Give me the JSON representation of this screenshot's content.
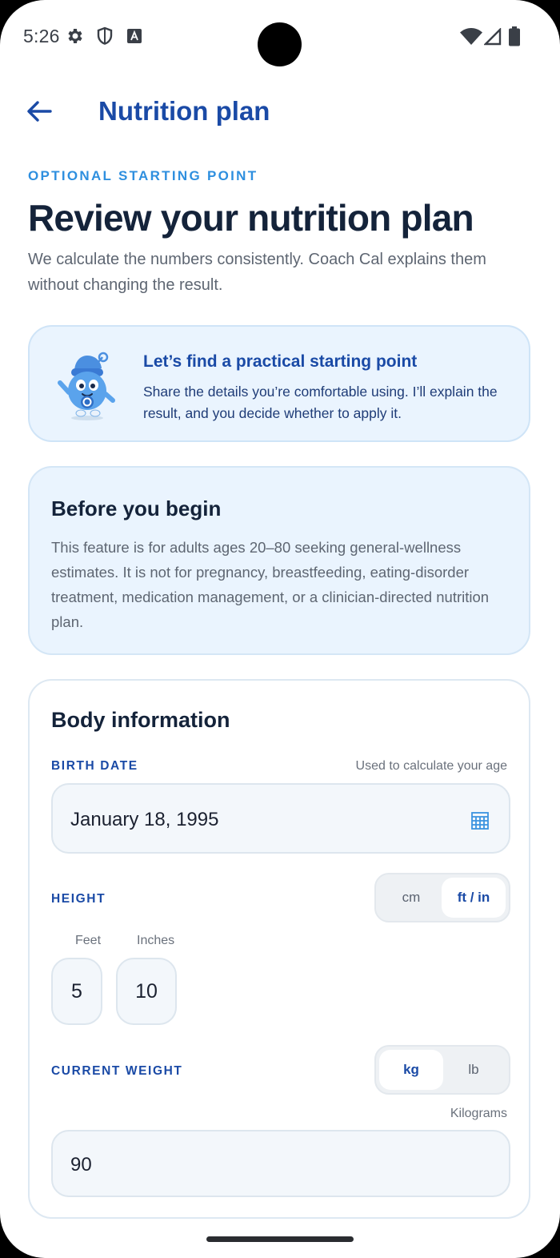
{
  "status_bar": {
    "time": "5:26",
    "icons": [
      "gear-icon",
      "shield-icon",
      "font-a-icon",
      "wifi-icon",
      "signal-icon",
      "battery-icon"
    ]
  },
  "app_bar": {
    "title": "Nutrition plan",
    "back_icon": "arrow-left-icon"
  },
  "header": {
    "eyebrow": "OPTIONAL STARTING POINT",
    "headline": "Review your nutrition plan",
    "subtitle": "We calculate the numbers consistently. Coach Cal explains them without changing the result."
  },
  "coach_card": {
    "title": "Let’s find a practical starting point",
    "text": "Share the details you’re comfortable using. I’ll explain the result, and you decide whether to apply it.",
    "mascot": "coach-cal-mascot"
  },
  "before_card": {
    "title": "Before you begin",
    "text": "This feature is for adults ages 20–80 seeking general-wellness estimates. It is not for pregnancy, breastfeeding, eating-disorder treatment, medication management, or a clinician-directed nutrition plan."
  },
  "body_info": {
    "title": "Body information",
    "birth_date": {
      "label": "BIRTH DATE",
      "hint": "Used to calculate your age",
      "value": "January 18, 1995",
      "icon": "calendar-icon"
    },
    "height": {
      "label": "HEIGHT",
      "units": [
        "cm",
        "ft / in"
      ],
      "selected_unit": "ft / in",
      "feet_label": "Feet",
      "inches_label": "Inches",
      "feet_value": "5",
      "inches_value": "10"
    },
    "weight": {
      "label": "CURRENT WEIGHT",
      "units": [
        "kg",
        "lb"
      ],
      "selected_unit": "kg",
      "unit_hint": "Kilograms",
      "value": "90"
    }
  },
  "colors": {
    "primary": "#1a4aa6",
    "accent": "#2e8fdf",
    "card_tint": "#eaf4fe",
    "heading": "#14233a"
  }
}
